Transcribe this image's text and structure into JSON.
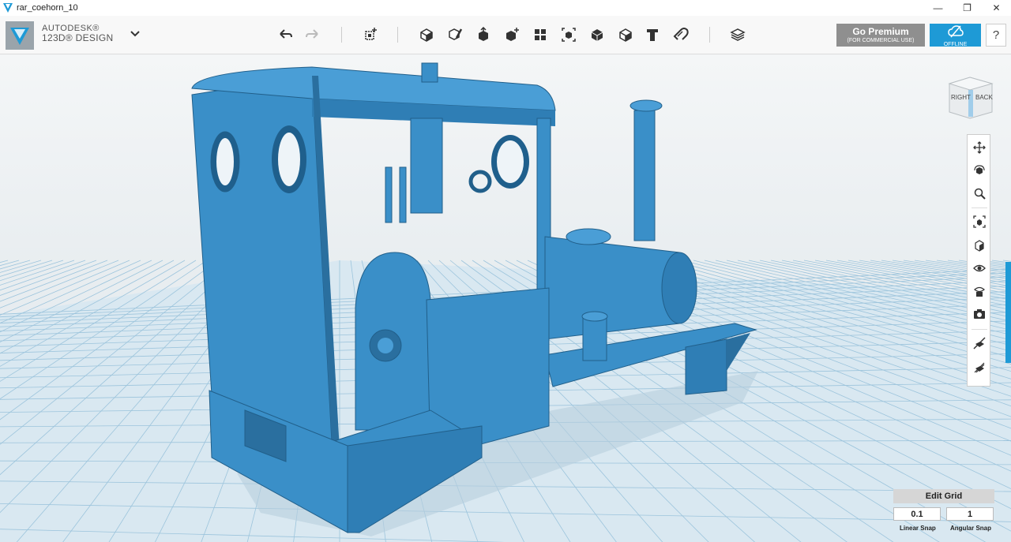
{
  "window": {
    "title": "rar_coehorn_10",
    "minimize": "—",
    "maximize": "❐",
    "close": "✕"
  },
  "brand": {
    "line1": "AUTODESK®",
    "line2": "123D® DESIGN"
  },
  "toolbar": {
    "icons": [
      "undo-icon",
      "redo-icon",
      "primitives-icon",
      "sketch-icon",
      "construct-icon",
      "modify-icon",
      "pattern-icon",
      "grouping-icon",
      "combine-icon",
      "measure-icon",
      "text-icon",
      "snap-icon",
      "materials-icon"
    ]
  },
  "premium": {
    "label": "Go Premium",
    "sub": "(FOR COMMERCIAL USE)"
  },
  "offline": {
    "label": "OFFLINE"
  },
  "help": {
    "label": "?"
  },
  "viewcube": {
    "left": "RIGHT",
    "right": "BACK"
  },
  "navbar": {
    "icons": [
      "pan-icon",
      "orbit-icon",
      "zoom-icon",
      "fit-icon",
      "views-icon",
      "visibility-icon",
      "material-view-icon",
      "camera-icon",
      "hide-icon",
      "show-icon"
    ]
  },
  "grid": {
    "edit_label": "Edit Grid",
    "linear_value": "0.1",
    "angular_value": "1",
    "linear_label": "Linear Snap",
    "angular_label": "Angular Snap"
  },
  "colors": {
    "model": "#3a8fc8",
    "model_dark": "#2a6f9f",
    "accent": "#1e9ad6",
    "grid_bg": "#e6eef4"
  }
}
